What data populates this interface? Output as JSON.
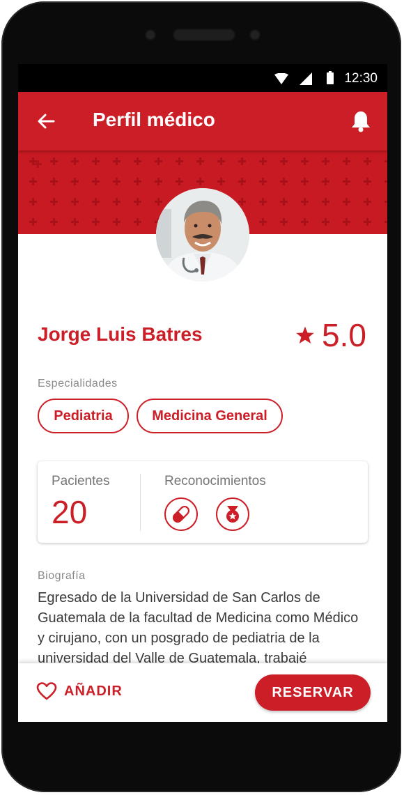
{
  "status_bar": {
    "time": "12:30"
  },
  "app_bar": {
    "title": "Perfil médico"
  },
  "doctor": {
    "name": "Jorge Luis Batres",
    "rating": "5.0"
  },
  "specialties": {
    "label": "Especialidades",
    "items": [
      "Pediatria",
      "Medicina General"
    ]
  },
  "stats": {
    "patients_label": "Pacientes",
    "patients_value": "20",
    "recognitions_label": "Reconocimientos",
    "recognition_icons": [
      "capsule-icon",
      "medal-icon"
    ]
  },
  "biography": {
    "label": "Biografía",
    "text": "Egresado de la Universidad de San Carlos de Guatemala de la facultad de Medicina como Médico y cirujano, con un posgrado de pediatria de la universidad del Valle de Guatemala, trabajé"
  },
  "actions": {
    "add_label": "AÑADIR",
    "reserve_label": "RESERVAR"
  },
  "colors": {
    "primary": "#cc1e27",
    "text": "#3a3a3a",
    "muted": "#8a8a8a"
  }
}
